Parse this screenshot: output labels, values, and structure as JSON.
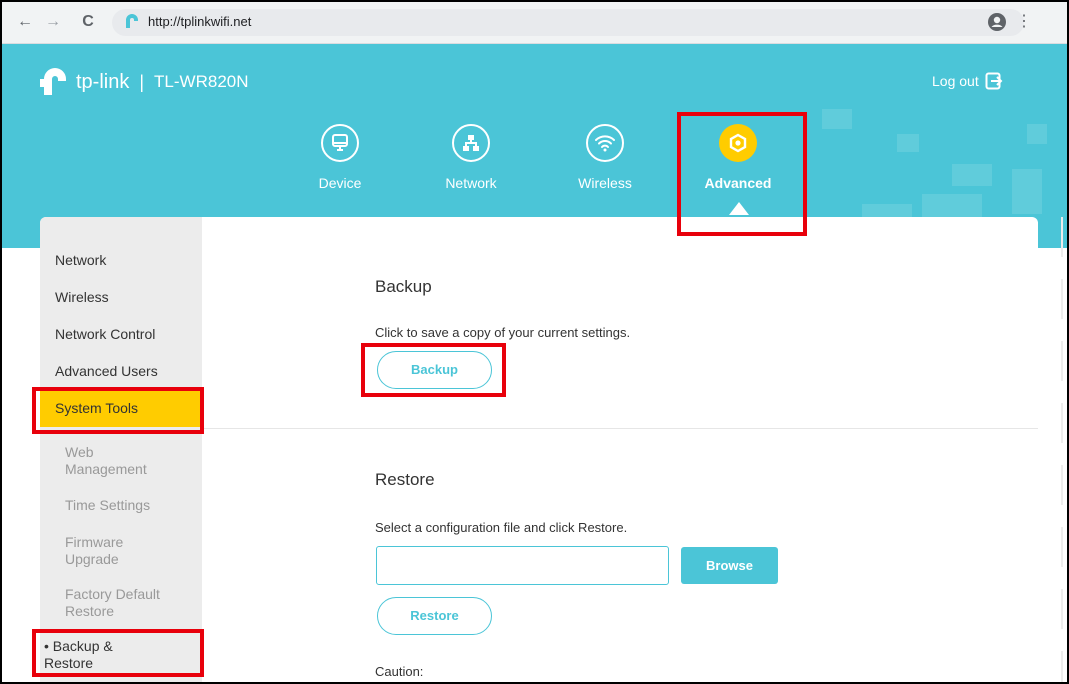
{
  "browser": {
    "back": "←",
    "forward": "→",
    "reload": "C",
    "url": "http://tplinkwifi.net",
    "menu": "⋮"
  },
  "header": {
    "brand": "tp-link",
    "separator": "|",
    "model": "TL-WR820N",
    "logout_label": "Log out",
    "tabs": [
      {
        "label": "Device",
        "icon": "monitor-icon"
      },
      {
        "label": "Network",
        "icon": "network-icon"
      },
      {
        "label": "Wireless",
        "icon": "wifi-icon"
      },
      {
        "label": "Advanced",
        "icon": "gear-icon",
        "active": true
      }
    ],
    "accent": "#4bc5d7",
    "active_color": "#ffcc00"
  },
  "sidebar": {
    "items": [
      {
        "label": "Network"
      },
      {
        "label": "Wireless"
      },
      {
        "label": "Network Control"
      },
      {
        "label": "Advanced Users"
      },
      {
        "label": "System Tools",
        "active": true
      }
    ],
    "subitems": [
      {
        "label": "Web Management"
      },
      {
        "label": "Time Settings"
      },
      {
        "label": "Firmware Upgrade"
      },
      {
        "label": "Factory Default Restore"
      },
      {
        "label": "• Backup & Restore",
        "active": true
      }
    ]
  },
  "main": {
    "backup": {
      "title": "Backup",
      "description": "Click to save a copy of your current settings.",
      "button": "Backup"
    },
    "restore": {
      "title": "Restore",
      "description": "Select a configuration file and click Restore.",
      "file_value": "",
      "browse_button": "Browse",
      "button": "Restore"
    },
    "caution": "Caution:"
  },
  "highlight_color": "#e8000b"
}
